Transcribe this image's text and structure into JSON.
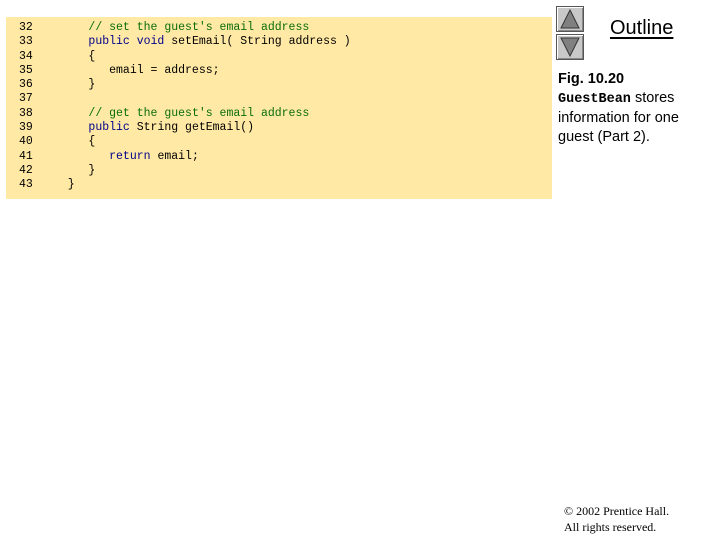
{
  "code": {
    "line_numbers": [
      "32",
      "33",
      "34",
      "35",
      "36",
      "37",
      "38",
      "39",
      "40",
      "41",
      "42",
      "43"
    ],
    "lines": [
      [
        {
          "t": "      ",
          "k": "plain"
        },
        {
          "t": "// set the guest's email address",
          "k": "comment"
        }
      ],
      [
        {
          "t": "      ",
          "k": "plain"
        },
        {
          "t": "public void",
          "k": "keyword"
        },
        {
          "t": " setEmail( String address )",
          "k": "plain"
        }
      ],
      [
        {
          "t": "      {",
          "k": "plain"
        }
      ],
      [
        {
          "t": "         email = address;",
          "k": "plain"
        }
      ],
      [
        {
          "t": "      }",
          "k": "plain"
        }
      ],
      [
        {
          "t": "",
          "k": "plain"
        }
      ],
      [
        {
          "t": "      ",
          "k": "plain"
        },
        {
          "t": "// get the guest's email address",
          "k": "comment"
        }
      ],
      [
        {
          "t": "      ",
          "k": "plain"
        },
        {
          "t": "public",
          "k": "keyword"
        },
        {
          "t": " String getEmail()",
          "k": "plain"
        }
      ],
      [
        {
          "t": "      {",
          "k": "plain"
        }
      ],
      [
        {
          "t": "         ",
          "k": "plain"
        },
        {
          "t": "return",
          "k": "keyword"
        },
        {
          "t": " email;",
          "k": "plain"
        }
      ],
      [
        {
          "t": "      }",
          "k": "plain"
        }
      ],
      [
        {
          "t": "   }",
          "k": "plain"
        }
      ]
    ]
  },
  "nav": {
    "prev_icon": "triangle-up-icon",
    "next_icon": "triangle-down-icon"
  },
  "outline": {
    "title": "Outline"
  },
  "caption": {
    "fig": "Fig. 10.20",
    "class_name": "GuestBean",
    "text": " stores information for one guest (Part 2)."
  },
  "copyright": {
    "line1": "© 2002 Prentice Hall.",
    "line2": "All rights reserved."
  },
  "colors": {
    "code_background": "#FFE9A5",
    "comment": "#0b6e0b",
    "keyword": "#00008b"
  }
}
